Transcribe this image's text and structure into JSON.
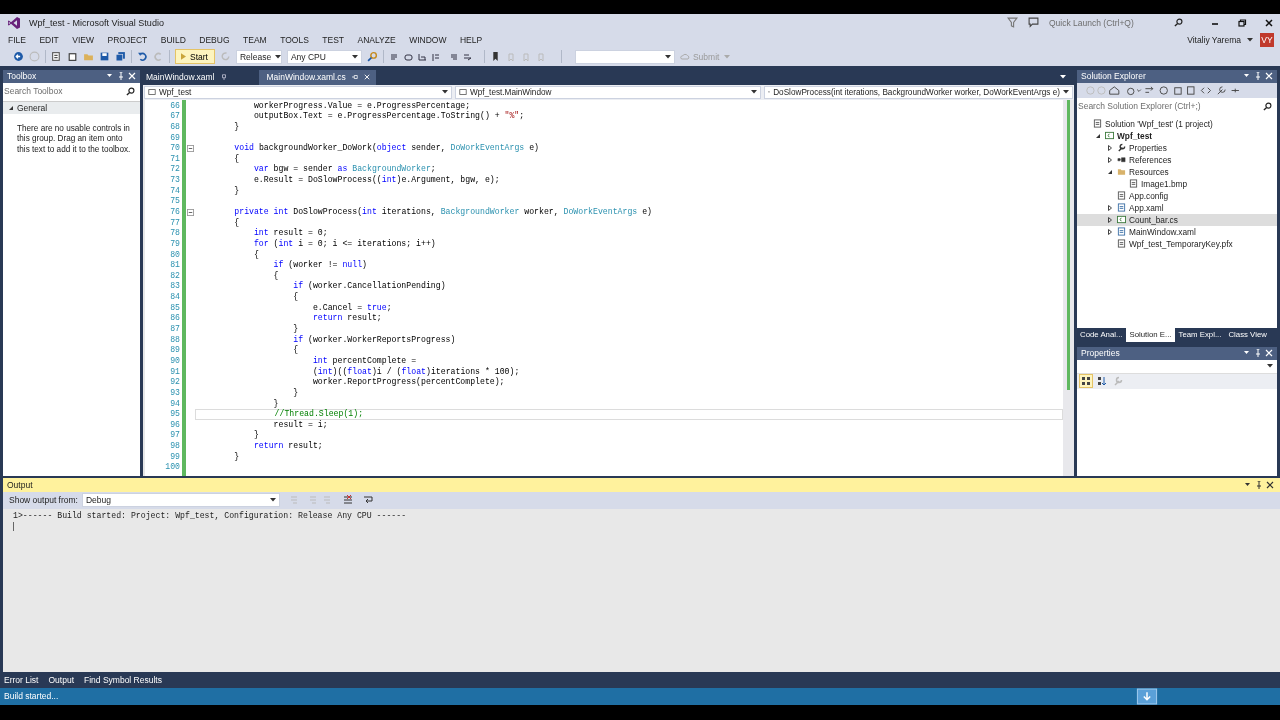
{
  "window": {
    "title": "Wpf_test - Microsoft Visual Studio"
  },
  "quick_launch": {
    "placeholder": "Quick Launch (Ctrl+Q)"
  },
  "account": {
    "name": "Vitaliy Yarema",
    "initials": "VY"
  },
  "menu": [
    "FILE",
    "EDIT",
    "VIEW",
    "PROJECT",
    "BUILD",
    "DEBUG",
    "TEAM",
    "TOOLS",
    "TEST",
    "ANALYZE",
    "WINDOW",
    "HELP"
  ],
  "toolbar": {
    "start": "Start",
    "configuration": "Release",
    "platform": "Any CPU",
    "submit": "Submit"
  },
  "toolbox": {
    "title": "Toolbox",
    "search": {
      "placeholder": "Search Toolbox"
    },
    "group": "General",
    "expanded": true,
    "message": "There are no usable controls in this group. Drag an item onto this text to add it to the toolbox."
  },
  "editor": {
    "tabs": [
      {
        "label": "MainWindow.xaml",
        "selected": false
      },
      {
        "label": "MainWindow.xaml.cs",
        "selected": true
      }
    ],
    "nav": [
      "Wpf_test",
      "Wpf_test.MainWindow",
      "DoSlowProcess(int iterations, BackgroundWorker worker, DoWorkEventArgs e)"
    ],
    "lines": [
      {
        "number": "66",
        "current": false,
        "fold": false,
        "tokens": [
          {
            "kind": "plain",
            "text": "            workerProgress.Value = e.ProgressPercentage;"
          }
        ]
      },
      {
        "number": "67",
        "current": false,
        "fold": false,
        "tokens": [
          {
            "kind": "plain",
            "text": "            outputBox.Text = e.ProgressPercentage.ToString() + "
          },
          {
            "kind": "string",
            "text": "\"%\""
          },
          {
            "kind": "plain",
            "text": ";"
          }
        ]
      },
      {
        "number": "68",
        "current": false,
        "fold": false,
        "tokens": [
          {
            "kind": "plain",
            "text": "        }"
          }
        ]
      },
      {
        "number": "69",
        "current": false,
        "fold": false
      },
      {
        "number": "70",
        "current": false,
        "fold": true,
        "tokens": [
          {
            "kind": "keyword",
            "text": "        void"
          },
          {
            "kind": "plain",
            "text": " backgroundWorker_DoWork("
          },
          {
            "kind": "keyword",
            "text": "object"
          },
          {
            "kind": "plain",
            "text": " sender, "
          },
          {
            "kind": "type",
            "text": "DoWorkEventArgs"
          },
          {
            "kind": "plain",
            "text": " e)"
          }
        ]
      },
      {
        "number": "71",
        "current": false,
        "fold": false,
        "tokens": [
          {
            "kind": "plain",
            "text": "        {"
          }
        ]
      },
      {
        "number": "72",
        "current": false,
        "fold": false,
        "tokens": [
          {
            "kind": "keyword",
            "text": "            var"
          },
          {
            "kind": "plain",
            "text": " bgw = sender "
          },
          {
            "kind": "keyword",
            "text": "as"
          },
          {
            "kind": "type",
            "text": " BackgroundWorker"
          },
          {
            "kind": "plain",
            "text": ";"
          }
        ]
      },
      {
        "number": "73",
        "current": false,
        "fold": false,
        "tokens": [
          {
            "kind": "plain",
            "text": "            e.Result = DoSlowProcess(("
          },
          {
            "kind": "keyword",
            "text": "int"
          },
          {
            "kind": "plain",
            "text": ")e.Argument, bgw, e);"
          }
        ]
      },
      {
        "number": "74",
        "current": false,
        "fold": false,
        "tokens": [
          {
            "kind": "plain",
            "text": "        }"
          }
        ]
      },
      {
        "number": "75",
        "current": false,
        "fold": false
      },
      {
        "number": "76",
        "current": false,
        "fold": true,
        "tokens": [
          {
            "kind": "keyword",
            "text": "        private int"
          },
          {
            "kind": "plain",
            "text": " DoSlowProcess("
          },
          {
            "kind": "keyword",
            "text": "int"
          },
          {
            "kind": "plain",
            "text": " iterations, "
          },
          {
            "kind": "type",
            "text": "BackgroundWorker"
          },
          {
            "kind": "plain",
            "text": " worker, "
          },
          {
            "kind": "type",
            "text": "DoWorkEventArgs"
          },
          {
            "kind": "plain",
            "text": " e)"
          }
        ]
      },
      {
        "number": "77",
        "current": false,
        "fold": false,
        "tokens": [
          {
            "kind": "plain",
            "text": "        {"
          }
        ]
      },
      {
        "number": "78",
        "current": false,
        "fold": false,
        "tokens": [
          {
            "kind": "keyword",
            "text": "            int"
          },
          {
            "kind": "plain",
            "text": " result = 0;"
          }
        ]
      },
      {
        "number": "79",
        "current": false,
        "fold": false,
        "tokens": [
          {
            "kind": "keyword",
            "text": "            for"
          },
          {
            "kind": "plain",
            "text": " ("
          },
          {
            "kind": "keyword",
            "text": "int"
          },
          {
            "kind": "plain",
            "text": " i = 0; i <= iterations; i++)"
          }
        ]
      },
      {
        "number": "80",
        "current": false,
        "fold": false,
        "tokens": [
          {
            "kind": "plain",
            "text": "            {"
          }
        ]
      },
      {
        "number": "81",
        "current": false,
        "fold": false,
        "tokens": [
          {
            "kind": "keyword",
            "text": "                if"
          },
          {
            "kind": "plain",
            "text": " (worker != "
          },
          {
            "kind": "keyword",
            "text": "null"
          },
          {
            "kind": "plain",
            "text": ")"
          }
        ]
      },
      {
        "number": "82",
        "current": false,
        "fold": false,
        "tokens": [
          {
            "kind": "plain",
            "text": "                {"
          }
        ]
      },
      {
        "number": "83",
        "current": false,
        "fold": false,
        "tokens": [
          {
            "kind": "keyword",
            "text": "                    if"
          },
          {
            "kind": "plain",
            "text": " (worker.CancellationPending)"
          }
        ]
      },
      {
        "number": "84",
        "current": false,
        "fold": false,
        "tokens": [
          {
            "kind": "plain",
            "text": "                    {"
          }
        ]
      },
      {
        "number": "85",
        "current": false,
        "fold": false,
        "tokens": [
          {
            "kind": "plain",
            "text": "                        e.Cancel = "
          },
          {
            "kind": "keyword",
            "text": "true"
          },
          {
            "kind": "plain",
            "text": ";"
          }
        ]
      },
      {
        "number": "86",
        "current": false,
        "fold": false,
        "tokens": [
          {
            "kind": "keyword",
            "text": "                        return"
          },
          {
            "kind": "plain",
            "text": " result;"
          }
        ]
      },
      {
        "number": "87",
        "current": false,
        "fold": false,
        "tokens": [
          {
            "kind": "plain",
            "text": "                    }"
          }
        ]
      },
      {
        "number": "88",
        "current": false,
        "fold": false,
        "tokens": [
          {
            "kind": "keyword",
            "text": "                    if"
          },
          {
            "kind": "plain",
            "text": " (worker.WorkerReportsProgress)"
          }
        ]
      },
      {
        "number": "89",
        "current": false,
        "fold": false,
        "tokens": [
          {
            "kind": "plain",
            "text": "                    {"
          }
        ]
      },
      {
        "number": "90",
        "current": false,
        "fold": false,
        "tokens": [
          {
            "kind": "keyword",
            "text": "                        int"
          },
          {
            "kind": "plain",
            "text": " percentComplete ="
          }
        ]
      },
      {
        "number": "91",
        "current": false,
        "fold": false,
        "tokens": [
          {
            "kind": "plain",
            "text": "                        ("
          },
          {
            "kind": "keyword",
            "text": "int"
          },
          {
            "kind": "plain",
            "text": ")(("
          },
          {
            "kind": "keyword",
            "text": "float"
          },
          {
            "kind": "plain",
            "text": ")i / ("
          },
          {
            "kind": "keyword",
            "text": "float"
          },
          {
            "kind": "plain",
            "text": ")iterations * 100);"
          }
        ]
      },
      {
        "number": "92",
        "current": false,
        "fold": false,
        "tokens": [
          {
            "kind": "plain",
            "text": "                        worker.ReportProgress(percentComplete);"
          }
        ]
      },
      {
        "number": "93",
        "current": false,
        "fold": false,
        "tokens": [
          {
            "kind": "plain",
            "text": "                    }"
          }
        ]
      },
      {
        "number": "94",
        "current": false,
        "fold": false,
        "tokens": [
          {
            "kind": "plain",
            "text": "                }"
          }
        ]
      },
      {
        "number": "95",
        "current": true,
        "fold": false,
        "tokens": [
          {
            "kind": "comment",
            "text": "                //Thread.Sleep(1);"
          }
        ]
      },
      {
        "number": "96",
        "current": false,
        "fold": false,
        "tokens": [
          {
            "kind": "plain",
            "text": "                result = i;"
          }
        ]
      },
      {
        "number": "97",
        "current": false,
        "fold": false,
        "tokens": [
          {
            "kind": "plain",
            "text": "            }"
          }
        ]
      },
      {
        "number": "98",
        "current": false,
        "fold": false,
        "tokens": [
          {
            "kind": "keyword",
            "text": "            return"
          },
          {
            "kind": "plain",
            "text": " result;"
          }
        ]
      },
      {
        "number": "99",
        "current": false,
        "fold": false,
        "tokens": [
          {
            "kind": "plain",
            "text": "        }"
          }
        ]
      },
      {
        "number": "100",
        "current": false,
        "fold": false
      }
    ]
  },
  "solution_explorer": {
    "title": "Solution Explorer",
    "search": {
      "placeholder": "Search Solution Explorer (Ctrl+;)"
    },
    "tree": [
      {
        "label": "Solution 'Wpf_test' (1 project)",
        "kind": "solution",
        "bold": false,
        "selected": false,
        "children": [
          {
            "label": "Wpf_test",
            "kind": "csproject",
            "expanded": true,
            "bold": true,
            "selected": false,
            "children": [
              {
                "label": "Properties",
                "kind": "properties",
                "expanded": false,
                "bold": false,
                "selected": false
              },
              {
                "label": "References",
                "kind": "references",
                "expanded": false,
                "bold": false,
                "selected": false
              },
              {
                "label": "Resources",
                "kind": "folder",
                "expanded": true,
                "bold": false,
                "selected": false,
                "children": [
                  {
                    "label": "Image1.bmp",
                    "kind": "image",
                    "bold": false,
                    "selected": false
                  }
                ]
              },
              {
                "label": "App.config",
                "kind": "config",
                "bold": false,
                "selected": false
              },
              {
                "label": "App.xaml",
                "kind": "xaml",
                "expanded": false,
                "bold": false,
                "selected": false
              },
              {
                "label": "Count_bar.cs",
                "kind": "cs",
                "expanded": false,
                "bold": false,
                "selected": true
              },
              {
                "label": "MainWindow.xaml",
                "kind": "xaml",
                "expanded": false,
                "bold": false,
                "selected": false
              },
              {
                "label": "Wpf_test_TemporaryKey.pfx",
                "kind": "key",
                "bold": false,
                "selected": false
              }
            ]
          }
        ]
      }
    ],
    "tabs": [
      {
        "label": "Code Anal...",
        "selected": false
      },
      {
        "label": "Solution E...",
        "selected": true
      },
      {
        "label": "Team Expl...",
        "selected": false
      },
      {
        "label": "Class View",
        "selected": false
      }
    ]
  },
  "properties": {
    "title": "Properties"
  },
  "output": {
    "title": "Output",
    "source_label": "Show output from:",
    "source": "Debug",
    "lines": [
      "1>------ Build started: Project: Wpf_test, Configuration: Release Any CPU ------"
    ]
  },
  "bottom_tabs": [
    "Error List",
    "Output",
    "Find Symbol Results"
  ],
  "status_bar": {
    "text": "Build started..."
  }
}
